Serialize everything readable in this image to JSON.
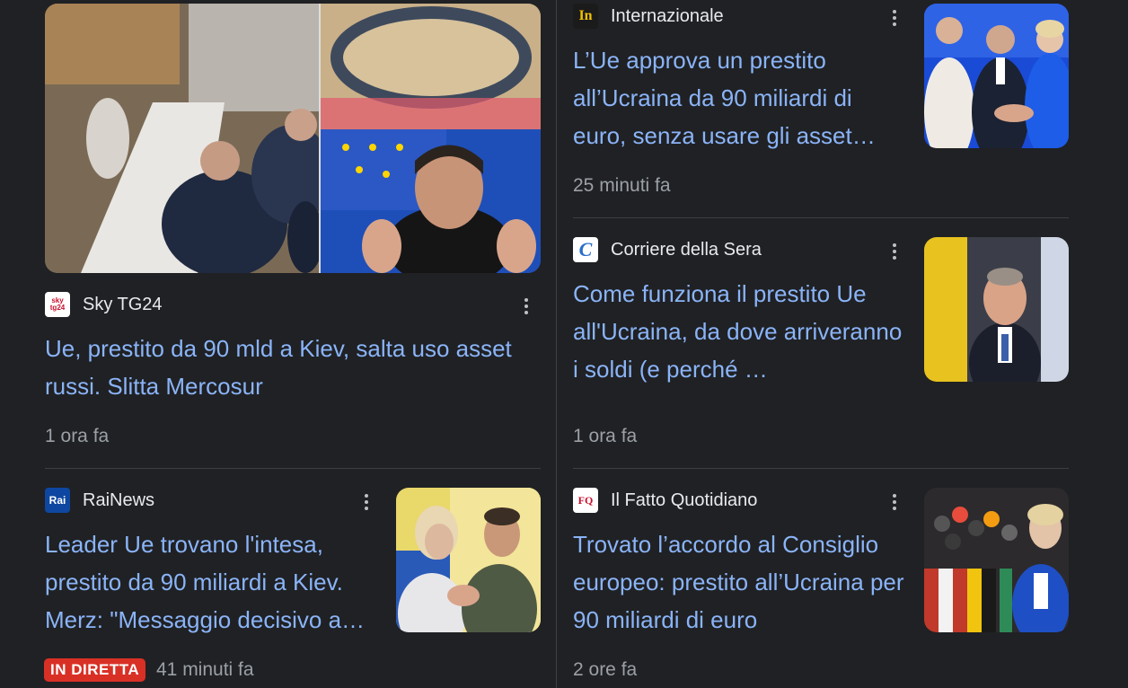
{
  "articles": [
    {
      "source": "Sky TG24",
      "logo_text": "sky tg24",
      "title": "Ue, prestito da 90 mld a Kiev, salta uso asset russi. Slitta Mercosur",
      "time": "1 ora fa",
      "image": "eu-council-meeting-and-zelensky-photo"
    },
    {
      "source": "Internazionale",
      "logo_text": "In",
      "title": "L’Ue approva un prestito all’Ucraina da 90 miliardi di euro, senza usare gli asset…",
      "time": "25 minuti fa",
      "image": "eu-leaders-handshake-photo"
    },
    {
      "source": "Corriere della Sera",
      "logo_text": "C",
      "title": "Come funziona il prestito Ue all'Ucraina, da dove arriveranno i soldi (e perché …",
      "time": "1 ora fa",
      "image": "politician-portrait-photo"
    },
    {
      "source": "RaiNews",
      "logo_text": "Rai",
      "title": "Leader Ue trovano l'intesa, prestito da 90 miliardi a Kiev. Merz: \"Messaggio decisivo a…",
      "badge": "IN DIRETTA",
      "time": "41 minuti fa",
      "image": "von-der-leyen-zelensky-embrace-photo"
    },
    {
      "source": "Il Fatto Quotidiano",
      "logo_text": "FQ",
      "title": "Trovato l’accordo al Consiglio europeo: prestito all’Ucraina per 90 miliardi di euro",
      "time": "2 ore fa",
      "image": "von-der-leyen-press-microphones-photo"
    }
  ],
  "colors": {
    "background": "#202124",
    "headline": "#8ab4f8",
    "meta": "#9aa0a6",
    "live_badge": "#d93025"
  }
}
